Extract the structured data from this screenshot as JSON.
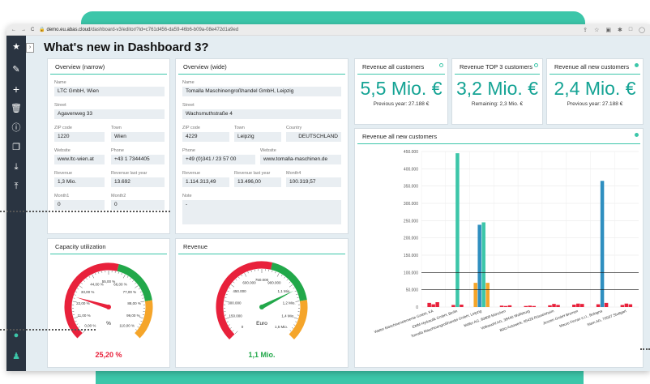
{
  "browser": {
    "url_domain": "demo.eu.abas.cloud",
    "url_path": "/dashboard-v3/editor/?id=c761d456-da59-46b6-b09a-08e472d1a9ed",
    "nav": [
      "←",
      "→",
      "C"
    ],
    "toolbar_icons": [
      "share-icon",
      "star-icon",
      "extension-icon",
      "puzzle-icon",
      "window-icon",
      "profile-icon"
    ]
  },
  "page": {
    "title": "What's new in Dashboard 3?"
  },
  "sidebar": {
    "icons": [
      "star-icon",
      "pencil-icon",
      "plus-icon",
      "trash-icon",
      "info-icon",
      "copy-icon",
      "download-icon",
      "upload-icon",
      "chat-icon",
      "user-icon"
    ]
  },
  "overview_narrow": {
    "title": "Overview (narrow)",
    "name_label": "Name",
    "name": "LTC GmbH, Wien",
    "street_label": "Street",
    "street": "Agavenweg 33",
    "zip_label": "ZIP code",
    "zip": "1220",
    "town_label": "Town",
    "town": "Wien",
    "website_label": "Website",
    "website": "www.ltc-wien.at",
    "phone_label": "Phone",
    "phone": "+43 1 7344405",
    "revenue_label": "Revenue",
    "revenue": "1,3 Mio.",
    "revenue_ly_label": "Revenue last year",
    "revenue_ly": "13.692",
    "month1_label": "Month1",
    "month1": "0",
    "month2_label": "Month2",
    "month2": "0"
  },
  "overview_wide": {
    "title": "Overview (wide)",
    "name_label": "Name",
    "name": "Tomalla Maschinengroßhandel GmbH, Leipzig",
    "street_label": "Street",
    "street": "Wachsmuthstraße 4",
    "zip_label": "ZIP code",
    "zip": "4229",
    "town_label": "Town",
    "town": "Leipzig",
    "country_label": "Country",
    "country": "DEUTSCHLAND",
    "phone_label": "Phone",
    "phone": "+49 (0)341 / 23 57 00",
    "website_label": "Website",
    "website": "www.tomalla-maschinen.de",
    "revenue_label": "Revenue",
    "revenue": "1.114.313,49",
    "revenue_ly_label": "Revenue last year",
    "revenue_ly": "13.496,00",
    "month4_label": "Month4",
    "month4": "100.319,57",
    "note_label": "Note",
    "note": "-"
  },
  "kpis": [
    {
      "title": "Revenue all customers",
      "value": "5,5 Mio. €",
      "sub": "Previous year: 27.188 €"
    },
    {
      "title": "Revenue TOP 3 customers",
      "value": "3,2 Mio. €",
      "sub": "Remaining: 2,3 Mio. €"
    },
    {
      "title": "Revenue all new customers",
      "value": "2,4 Mio. €",
      "sub": "Previous year: 27.188 €"
    }
  ],
  "capacity": {
    "title": "Capacity utilization",
    "value_text": "25,20 %",
    "unit": "%",
    "value": 25.2,
    "min": 0,
    "max": 110,
    "ticks": [
      "0,00 %",
      "11,00 %",
      "22,00 %",
      "33,00 %",
      "44,00 %",
      "55,00 %",
      "66,00 %",
      "77,00 %",
      "88,00 %",
      "99,00 %",
      "110,00 %"
    ],
    "colors": {
      "low": "#e8213b",
      "mid": "#22a84a",
      "high": "#f5a52a",
      "value": "#e8213b"
    }
  },
  "revenue_gauge": {
    "title": "Revenue",
    "value_text": "1,1 Mio.",
    "unit": "Euro",
    "value": 1100000,
    "min": 0,
    "max": 1500000,
    "ticks": [
      "0",
      "150.000",
      "300.000",
      "450.000",
      "600.000",
      "750.000",
      "900.000",
      "1,1 Mio.",
      "1,2 Mio.",
      "1,4 Mio.",
      "1,5 Mio."
    ],
    "colors": {
      "low": "#e8213b",
      "mid": "#22a84a",
      "high": "#f5a52a",
      "value": "#22a84a"
    }
  },
  "chart_data": {
    "type": "bar",
    "title": "Revenue all new customers",
    "ylim": [
      0,
      450000
    ],
    "yticks": [
      "0",
      "50.000",
      "100.000",
      "150.000",
      "200.000",
      "250.000",
      "300.000",
      "350.000",
      "400.000",
      "450.000"
    ],
    "ytick_values": [
      0,
      50000,
      100000,
      150000,
      200000,
      250000,
      300000,
      350000,
      400000,
      450000
    ],
    "threshold_lines": [
      50000,
      100000
    ],
    "categories": [
      "Walter Maschinenelemente GmbH, KA",
      "EMM Hydraulik GmbH, Berlin",
      "Tomalla Maschinengroßhandel GmbH, Leipzig",
      "Möller AG, 80809 München",
      "Volkswohl AG, 38440 Wolfsburg",
      "Bötz Autowerk, 65428 Rüsselsheim",
      "Jenzen GmbH Bremen",
      "Mauro Ferrari s.r.l., Bologna",
      "Stein AG, 70567 Stuttgart"
    ],
    "series": [
      {
        "color": "#e8213b",
        "values": [
          12000,
          10000,
          11000,
          4000,
          4000,
          3500,
          9000,
          14000,
          10000
        ]
      },
      {
        "color": "#3cc6a9",
        "values": [
          0,
          445000,
          0,
          0,
          0,
          0,
          0,
          0,
          0
        ]
      },
      {
        "color": "#2f8fc0",
        "values": [
          0,
          0,
          240000,
          0,
          0,
          0,
          0,
          365000,
          0
        ]
      },
      {
        "color": "#f5a52a",
        "values": [
          0,
          0,
          70000,
          0,
          0,
          0,
          0,
          0,
          0
        ]
      }
    ],
    "bar_groups": [
      [
        [
          "#e8213b",
          12000
        ],
        [
          "#e8213b",
          8000
        ],
        [
          "#e8213b",
          14000
        ]
      ],
      [
        [
          "#e8213b",
          6000
        ],
        [
          "#3cc6a9",
          445000
        ],
        [
          "#e8213b",
          7000
        ]
      ],
      [
        [
          "#f5a52a",
          70000
        ],
        [
          "#2f8fc0",
          238000
        ],
        [
          "#3cc6a9",
          245000
        ],
        [
          "#f5a52a",
          70000
        ]
      ],
      [
        [
          "#e8213b",
          4000
        ],
        [
          "#e8213b",
          3000
        ],
        [
          "#e8213b",
          5000
        ]
      ],
      [
        [
          "#e8213b",
          3000
        ],
        [
          "#e8213b",
          4000
        ],
        [
          "#e8213b",
          3000
        ]
      ],
      [
        [
          "#e8213b",
          5000
        ],
        [
          "#e8213b",
          9000
        ],
        [
          "#e8213b",
          6000
        ]
      ],
      [
        [
          "#e8213b",
          7000
        ],
        [
          "#e8213b",
          10000
        ],
        [
          "#e8213b",
          9000
        ]
      ],
      [
        [
          "#e8213b",
          8000
        ],
        [
          "#2f8fc0",
          365000
        ],
        [
          "#e8213b",
          12000
        ]
      ],
      [
        [
          "#e8213b",
          6000
        ],
        [
          "#e8213b",
          10000
        ],
        [
          "#e8213b",
          8000
        ]
      ]
    ],
    "grid": true
  }
}
